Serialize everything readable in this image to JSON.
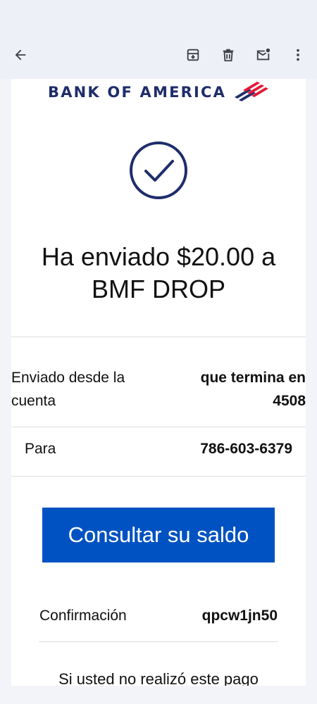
{
  "toolbar": {
    "back_icon": "arrow-back-icon",
    "archive_icon": "archive-icon",
    "delete_icon": "trash-icon",
    "unread_icon": "mark-unread-icon",
    "more_icon": "more-vert-icon"
  },
  "email": {
    "brand": "BANK OF AMERICA",
    "brand_colors": {
      "blue": "#1f2d6b",
      "red": "#e31837"
    },
    "headline_line1": "Ha enviado $20.00 a",
    "headline_line2": "BMF DROP",
    "from_label_line1": "Enviado desde la",
    "from_label_line2": "cuenta",
    "from_value_line1": "que termina en",
    "from_value_line2": "4508",
    "to_label": "Para",
    "to_value": "786-603-6379",
    "cta_label": "Consultar su saldo",
    "cta_color": "#0052c2",
    "confirmation_label": "Confirmación",
    "confirmation_value": "qpcw1jn50",
    "footer_partial": "Si usted no realizó este pago"
  }
}
